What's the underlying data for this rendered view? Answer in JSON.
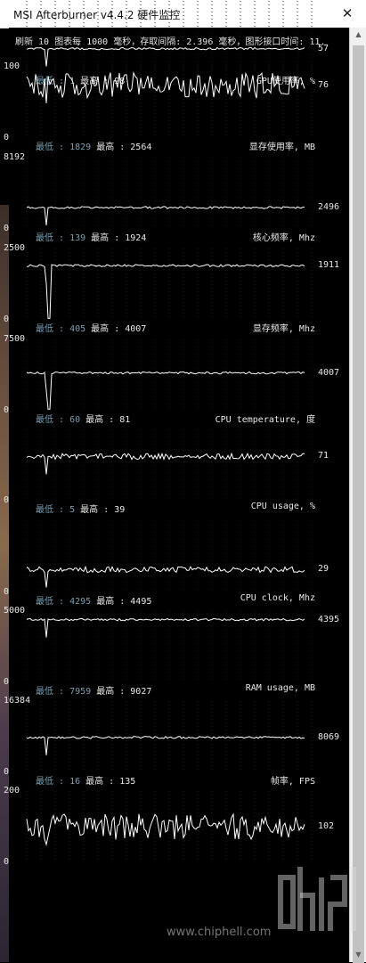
{
  "window": {
    "title": "MSI Afterburner v4.4.2 硬件监控",
    "status_line": "刷新 10 图表每 1000 毫秒，存取间隔: 2.396 毫秒，图形接口时间: 11."
  },
  "graphs": [
    {
      "name": "GPU",
      "header": "",
      "min_label": "",
      "max_label": "",
      "min_value": "",
      "max_value": "",
      "y_max": "",
      "y_min": "",
      "current": "57",
      "mean": 0.33
    },
    {
      "name": "GPU使用率",
      "header": "GPU使用率, %",
      "min_label": "最低 :",
      "max_label": "最高 :",
      "min_value": "1",
      "max_value": "98",
      "y_max": "100",
      "y_min": "0",
      "current": "76",
      "mean": 0.74
    },
    {
      "name": "显存使用率",
      "header": "显存使用率, MB",
      "min_label": "最低 :",
      "max_label": "最高 :",
      "min_value": "1829",
      "max_value": "2564",
      "y_max": "8192",
      "y_min": "0",
      "current": "2496",
      "mean": 0.3
    },
    {
      "name": "核心频率",
      "header": "核心频率, Mhz",
      "min_label": "最低 :",
      "max_label": "最高 :",
      "min_value": "139",
      "max_value": "1924",
      "y_max": "2500",
      "y_min": "0",
      "current": "1911",
      "mean": 0.76
    },
    {
      "name": "显存频率",
      "header": "显存频率, Mhz",
      "min_label": "最低 :",
      "max_label": "最高 :",
      "min_value": "405",
      "max_value": "4007",
      "y_max": "7500",
      "y_min": "0",
      "current": "4007",
      "mean": 0.53
    },
    {
      "name": "CPU temperature",
      "header": "CPU temperature, 度",
      "min_label": "最低 :",
      "max_label": "最高 :",
      "min_value": "60",
      "max_value": "81",
      "y_max": "",
      "y_min": "0",
      "current": "71",
      "mean": 0.62
    },
    {
      "name": "CPU usage",
      "header": "CPU usage, %",
      "min_label": "最低 :",
      "max_label": "最高 :",
      "min_value": "5",
      "max_value": "39",
      "y_max": "",
      "y_min": "0",
      "current": "29",
      "mean": 0.32
    },
    {
      "name": "CPU clock",
      "header": "CPU clock, Mhz",
      "min_label": "最低 :",
      "max_label": "最高 :",
      "min_value": "4295",
      "max_value": "4495",
      "y_max": "5000",
      "y_min": "0",
      "current": "4395",
      "mean": 0.88
    },
    {
      "name": "RAM usage",
      "header": "RAM usage, MB",
      "min_label": "最低 :",
      "max_label": "最高 :",
      "min_value": "7959",
      "max_value": "9027",
      "y_max": "16384",
      "y_min": "0",
      "current": "8069",
      "mean": 0.49
    },
    {
      "name": "帧率",
      "header": "帧率, FPS",
      "min_label": "最低 :",
      "max_label": "最高 :",
      "min_value": "16",
      "max_value": "135",
      "y_max": "200",
      "y_min": "0",
      "current": "102",
      "mean": 0.5
    }
  ],
  "watermark": {
    "text": "www.chiphell.com"
  },
  "colors": {
    "background": "#000000",
    "trace": "#ffffff",
    "min_text": "#7a9fb0"
  }
}
